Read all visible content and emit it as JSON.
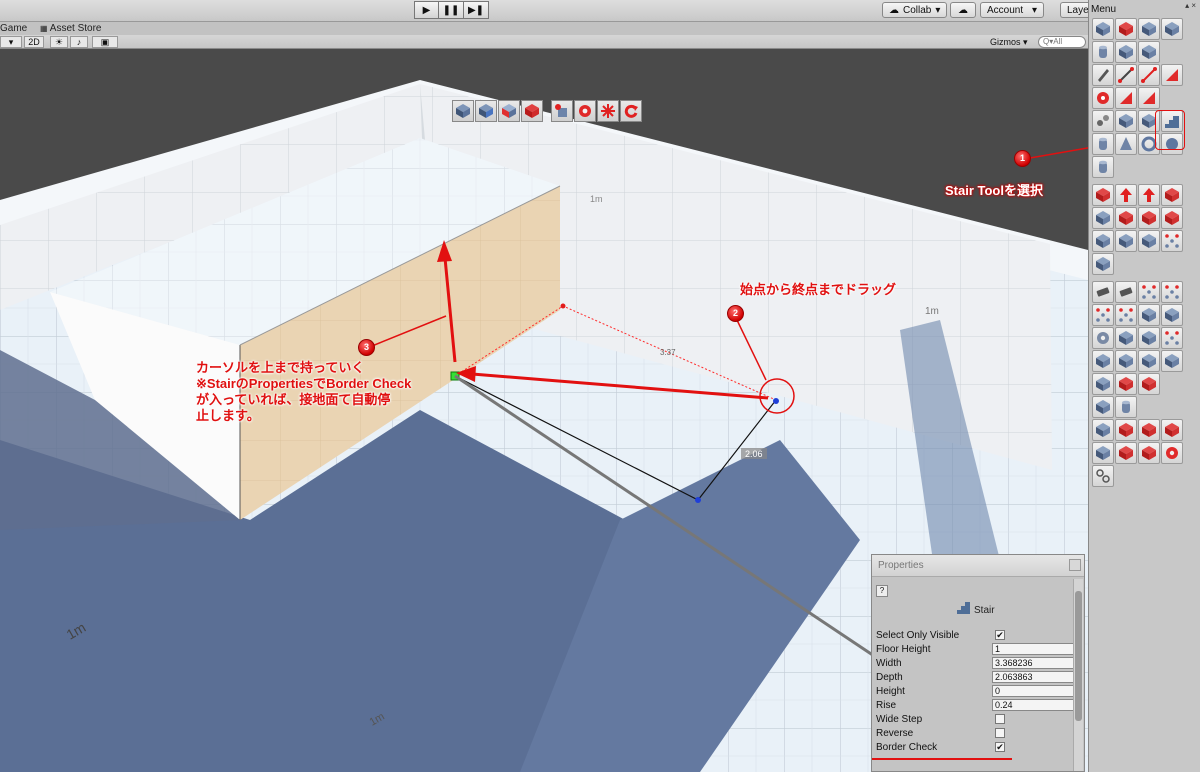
{
  "toolbar": {
    "play": "▶",
    "pause": "❚❚",
    "step": "▶❚",
    "collab_label": "Collab",
    "cloud_icon": "cloud-icon",
    "account_label": "Account",
    "layers_label": "Laye",
    "dropdown_arrow": "▾"
  },
  "tabs": {
    "game": "Game",
    "asset_store": "Asset Store"
  },
  "scene_bar": {
    "mode_2d": "2D",
    "light_icon": "☀",
    "image_icon": "▣",
    "gizmos_label": "Gizmos",
    "search_placeholder": "Q▾All"
  },
  "right_panel": {
    "title": "Menu",
    "close_label": "▴ ×"
  },
  "properties": {
    "title": "Properties",
    "help": "?",
    "object_name": "Stair",
    "rows": [
      {
        "label": "Select Only Visible",
        "kind": "check",
        "value": "✔"
      },
      {
        "label": "Floor Height",
        "kind": "field",
        "value": "1"
      },
      {
        "label": "Width",
        "kind": "field",
        "value": "3.368236"
      },
      {
        "label": "Depth",
        "kind": "field",
        "value": "2.063863"
      },
      {
        "label": "Height",
        "kind": "field",
        "value": "0"
      },
      {
        "label": "Rise",
        "kind": "field",
        "value": "0.24"
      },
      {
        "label": "Wide Step",
        "kind": "check",
        "value": ""
      },
      {
        "label": "Reverse",
        "kind": "check",
        "value": ""
      },
      {
        "label": "Border Check",
        "kind": "check",
        "value": "✔"
      }
    ]
  },
  "annotations": {
    "badge1": "1",
    "badge2": "2",
    "badge3": "3",
    "note1": "Stair Toolを選択",
    "note2": "始点から終点までドラッグ",
    "note3_line1": "カーソルを上まで持っていく",
    "note3_line2": "※StairのPropertiesでBorder Check",
    "note3_line3": "が入っていれば、接地面て自動停",
    "note3_line4": "止します。"
  },
  "scene_labels": {
    "grid_unit": "1m",
    "dim_depth": "2.06",
    "dim_width": "3.37"
  },
  "colors": {
    "annotation_red": "#e01010",
    "floor_shadow": "#5a6f94",
    "box_side": "#e8d2b2",
    "selection_red": "#ff0000"
  }
}
